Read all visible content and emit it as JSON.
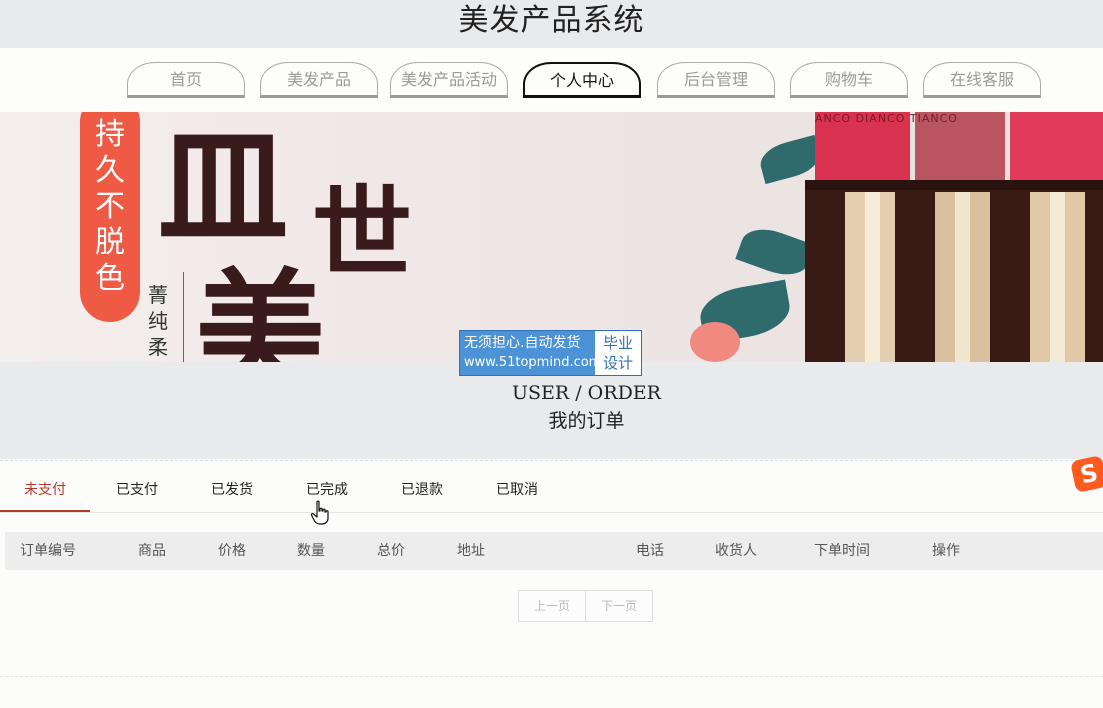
{
  "header": {
    "title": "美发产品系统"
  },
  "nav": {
    "items": [
      {
        "label": "首页"
      },
      {
        "label": "美发产品"
      },
      {
        "label": "美发产品活动"
      },
      {
        "label": "个人中心",
        "active": true
      },
      {
        "label": "后台管理"
      },
      {
        "label": "购物车"
      },
      {
        "label": "在线客服"
      }
    ]
  },
  "banner": {
    "pill_text": "持久不脱色",
    "big_chars": [
      "皿",
      "世",
      "美"
    ],
    "sub_text": "菁纯柔",
    "lipstick_brand": "ANCO DIANCO TIANCO"
  },
  "watermark": {
    "line1": "无须担心.自动发货",
    "line2": "www.51topmind.com",
    "badge1": "毕业",
    "badge2": "设计"
  },
  "section": {
    "en": "USER / ORDER",
    "cn": "我的订单"
  },
  "tabs": [
    {
      "label": "未支付",
      "active": true
    },
    {
      "label": "已支付"
    },
    {
      "label": "已发货"
    },
    {
      "label": "已完成"
    },
    {
      "label": "已退款"
    },
    {
      "label": "已取消"
    }
  ],
  "table": {
    "columns": [
      "订单编号",
      "商品",
      "价格",
      "数量",
      "总价",
      "地址",
      "电话",
      "收货人",
      "下单时间",
      "操作"
    ]
  },
  "pager": {
    "prev": "上一页",
    "next": "下一页"
  },
  "colors": {
    "accent": "#b8362b",
    "header_bg": "#e9eaec",
    "banner_pill": "#ef5a45"
  },
  "icons": {
    "sogou": "sogou-input-icon",
    "cursor": "hand-pointer-icon"
  }
}
